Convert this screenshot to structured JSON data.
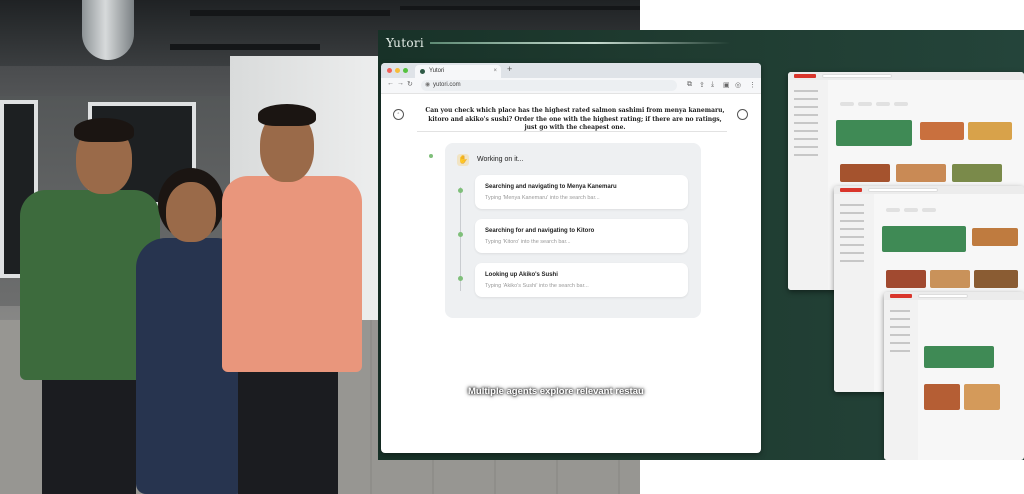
{
  "brand": "Yutori",
  "browser": {
    "tab_title": "Yutori",
    "tab_close": "×",
    "new_tab": "+",
    "url": "yutori.com",
    "nav_back": "←",
    "nav_forward": "→",
    "nav_reload": "↻"
  },
  "query": "Can you check which place has the highest rated salmon sashimi from menya kanemaru, kitoro and akiko's sushi? Order the one with the highest rating; if there are no ratings, just go with the cheapest one.",
  "working": {
    "label": "Working on it...",
    "steps": [
      {
        "title": "Searching and navigating to Menya Kanemaru",
        "detail": "Typing 'Menya Kanemaru' into the search bar..."
      },
      {
        "title": "Searching for and navigating to Kitoro",
        "detail": "Typing 'Kitoro' into the search bar..."
      },
      {
        "title": "Looking up Akiko's Sushi",
        "detail": "Typing 'Akiko's Sushi' into the search bar..."
      }
    ]
  },
  "caption": "Multiple agents explore relevant restau",
  "colors": {
    "panel": "#1f3b30",
    "accent_green": "#7fbf7a",
    "doordash_red": "#d9352b",
    "banner_green": "#3f8a55"
  }
}
